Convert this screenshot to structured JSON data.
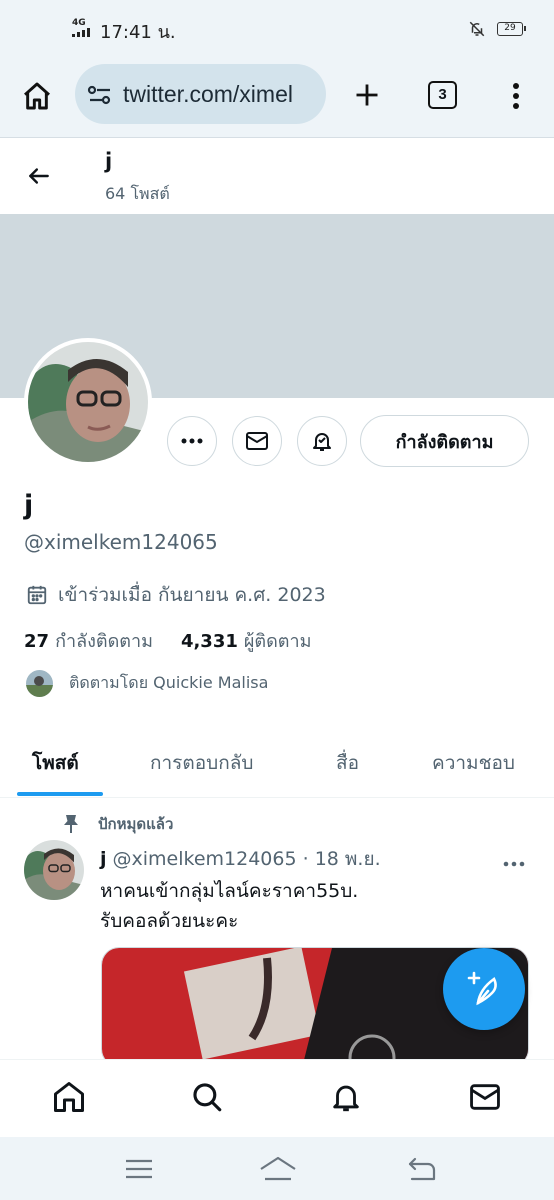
{
  "status_bar": {
    "network": "4G",
    "time": "17:41 น.",
    "battery": "29"
  },
  "browser": {
    "url": "twitter.com/ximel",
    "tab_count": "3"
  },
  "profile_header": {
    "name": "j",
    "post_count": "64 โพสต์"
  },
  "profile": {
    "display_name": "j",
    "handle": "@ximelkem124065",
    "joined": "เข้าร่วมเมื่อ กันยายน ค.ศ. 2023",
    "following_count": "27",
    "following_label": "กำลังติดตาม",
    "followers_count": "4,331",
    "followers_label": "ผู้ติดตาม",
    "followed_by": "ติดตามโดย Quickie Malisa",
    "following_button": "กำลังติดตาม"
  },
  "tabs": [
    {
      "label": "โพสต์",
      "active": true
    },
    {
      "label": "การตอบกลับ",
      "active": false
    },
    {
      "label": "สื่อ",
      "active": false
    },
    {
      "label": "ความชอบ",
      "active": false
    }
  ],
  "pinned_tweet": {
    "pinned_label": "ปักหมุดแล้ว",
    "author_name": "j",
    "author_handle_date": "@ximelkem124065 · 18 พ.ย.",
    "text_line1": "หาคนเข้ากลุ่มไลน์คะราคา55บ.",
    "text_line2": "รับคอลด้วยนะคะ"
  },
  "colors": {
    "accent": "#1d9bf0",
    "banner": "#cfd9de",
    "secondary_text": "#536471"
  },
  "icons": {
    "browser": [
      "home-icon",
      "tune-icon",
      "plus-icon",
      "tabs-icon",
      "more-vertical-icon"
    ],
    "bottom_nav": [
      "home-icon",
      "search-icon",
      "bell-icon",
      "mail-icon"
    ]
  }
}
